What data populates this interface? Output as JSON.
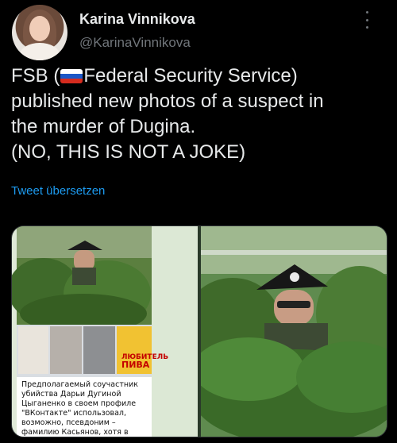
{
  "author": {
    "name": "Karina Vinnikova",
    "handle": "@KarinaVinnikova"
  },
  "tweet": {
    "line1_prefix": "FSB (",
    "line1_flag": "russia-flag",
    "line1_suffix": "Federal Security Service)",
    "line2": "published new photos of a suspect in",
    "line3": "the murder of Dugina.",
    "line4": "(NO, THIS IS NOT A JOKE)"
  },
  "translate_link": "Tweet übersetzen",
  "media": {
    "left_caption": "Предполагаемый соучастник убийства Дарьи Дугиной Цыганенко в своем профиле \"ВКонтакте\" использовал, возможно, псевдоним – фамилию Касьянов, хотя в аккаунте в \"Мой",
    "sign_text_1": "ЛЮБИТЕЛЬ",
    "sign_text_2": "ПИВА"
  },
  "colors": {
    "background": "#000000",
    "text": "#e7e9ea",
    "secondary": "#71767b",
    "link": "#1d9bf0"
  }
}
